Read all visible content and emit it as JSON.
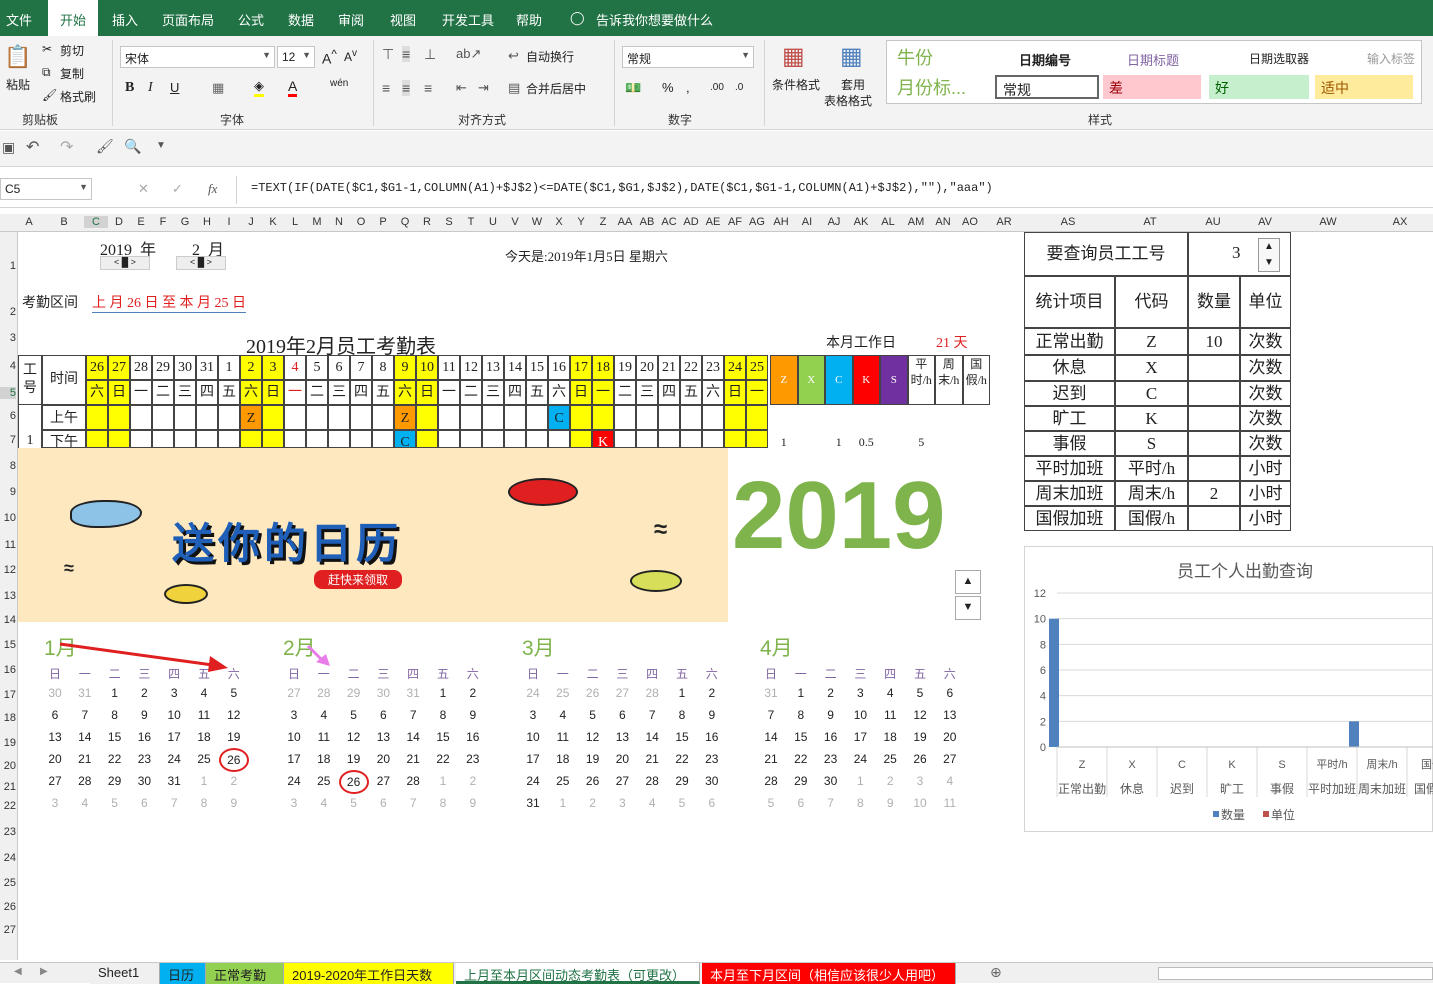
{
  "ribbon_tabs": [
    "文件",
    "开始",
    "插入",
    "页面布局",
    "公式",
    "数据",
    "审阅",
    "视图",
    "开发工具",
    "帮助",
    "告诉我你想要做什么"
  ],
  "clipboard": {
    "paste": "粘贴",
    "cut": "剪切",
    "copy": "复制",
    "format_painter": "格式刷",
    "group": "剪贴板"
  },
  "font": {
    "name": "宋体",
    "size": "12",
    "group": "字体"
  },
  "alignment": {
    "wrap": "自动换行",
    "merge": "合并后居中",
    "group": "对齐方式"
  },
  "number": {
    "format": "常规",
    "group": "数字",
    "percent": "%"
  },
  "styles": {
    "cond_format": "条件格式",
    "table_format_1": "套用",
    "table_format_2": "表格格式",
    "group": "样式",
    "items": [
      {
        "label": "牛份",
        "color": "#7fb34b"
      },
      {
        "label": "月份标...",
        "color": "#7fb34b"
      },
      {
        "label": "日期编号"
      },
      {
        "label": "日期标题"
      },
      {
        "label": "日期选取器"
      },
      {
        "label": "输入标签"
      },
      {
        "label": "常规"
      },
      {
        "label": "差"
      },
      {
        "label": "好"
      },
      {
        "label": "适中"
      }
    ]
  },
  "namebox": "C5",
  "formula": "=TEXT(IF(DATE($C1,$G1-1,COLUMN(A1)+$J$2)<=DATE($C1,$G1,$J$2),DATE($C1,$G1-1,COLUMN(A1)+$J$2),\"\"),\"aaa\")",
  "fx": "fx",
  "columns": [
    "A",
    "B",
    "C",
    "D",
    "E",
    "F",
    "G",
    "H",
    "I",
    "J",
    "K",
    "L",
    "M",
    "N",
    "O",
    "P",
    "Q",
    "R",
    "S",
    "T",
    "U",
    "V",
    "W",
    "X",
    "Y",
    "Z",
    "AA",
    "AB",
    "AC",
    "AD",
    "AE",
    "AF",
    "AG",
    "AH",
    "AI",
    "AJ",
    "AK",
    "AL",
    "AM",
    "AN",
    "AO",
    "AR",
    "AS",
    "AT",
    "AU",
    "AV",
    "AW",
    "AX"
  ],
  "rows": [
    "1",
    "2",
    "3",
    "4",
    "5",
    "6",
    "7",
    "8",
    "9",
    "10",
    "11",
    "12",
    "13",
    "14",
    "15",
    "16",
    "17",
    "18",
    "19",
    "20",
    "21",
    "22",
    "23",
    "24",
    "25",
    "26",
    "27"
  ],
  "sheet": {
    "year": "2019",
    "year_unit": "年",
    "month": "2",
    "month_unit": "月",
    "today": "今天是:2019年1月5日 星期六",
    "range_label": "考勤区间",
    "range_value": "上 月 26 日 至 本 月 25 日",
    "title": "2019年2月员工考勤表",
    "workdays_label": "本月工作日",
    "workdays_value": "21",
    "workdays_unit": "天",
    "col_id": "工号",
    "col_time": "时间",
    "dates": [
      "26",
      "27",
      "28",
      "29",
      "30",
      "31",
      "1",
      "2",
      "3",
      "4",
      "5",
      "6",
      "7",
      "8",
      "9",
      "10",
      "11",
      "12",
      "13",
      "14",
      "15",
      "16",
      "17",
      "18",
      "19",
      "20",
      "21",
      "22",
      "23",
      "24",
      "25"
    ],
    "weekdays": [
      "六",
      "日",
      "一",
      "二",
      "三",
      "四",
      "五",
      "六",
      "日",
      "一",
      "二",
      "三",
      "四",
      "五",
      "六",
      "日",
      "一",
      "二",
      "三",
      "四",
      "五",
      "六",
      "日",
      "一",
      "二",
      "三",
      "四",
      "五",
      "六",
      "日",
      "一"
    ],
    "summary_cols": [
      "Z",
      "X",
      "C",
      "K",
      "S",
      "平时/h",
      "周末/h",
      "国假/h"
    ],
    "am": "上午",
    "pm": "下午",
    "emp_id": "1",
    "marks": {
      "z1": "Z",
      "z2": "Z",
      "c1": "C",
      "c2": "C",
      "k1": "K"
    },
    "summary_vals": [
      "1",
      "1",
      "0.5",
      "5"
    ]
  },
  "banner": {
    "title": "送你的日历",
    "subtitle": "赶快来领取",
    "year": "2019"
  },
  "calendar": {
    "weekday_header": [
      "日",
      "一",
      "二",
      "三",
      "四",
      "五",
      "六"
    ],
    "months": [
      {
        "name": "1月",
        "days": [
          "30",
          "31",
          "1",
          "2",
          "3",
          "4",
          "5",
          "6",
          "7",
          "8",
          "9",
          "10",
          "11",
          "12",
          "13",
          "14",
          "15",
          "16",
          "17",
          "18",
          "19",
          "20",
          "21",
          "22",
          "23",
          "24",
          "25",
          "26",
          "27",
          "28",
          "29",
          "30",
          "31",
          "1",
          "2",
          "3",
          "4",
          "5",
          "6",
          "7",
          "8",
          "9"
        ]
      },
      {
        "name": "2月",
        "days": [
          "27",
          "28",
          "29",
          "30",
          "31",
          "1",
          "2",
          "3",
          "4",
          "5",
          "6",
          "7",
          "8",
          "9",
          "10",
          "11",
          "12",
          "13",
          "14",
          "15",
          "16",
          "17",
          "18",
          "19",
          "20",
          "21",
          "22",
          "23",
          "24",
          "25",
          "26",
          "27",
          "28",
          "1",
          "2",
          "3",
          "4",
          "5",
          "6",
          "7",
          "8",
          "9"
        ]
      },
      {
        "name": "3月",
        "days": [
          "24",
          "25",
          "26",
          "27",
          "28",
          "1",
          "2",
          "3",
          "4",
          "5",
          "6",
          "7",
          "8",
          "9",
          "10",
          "11",
          "12",
          "13",
          "14",
          "15",
          "16",
          "17",
          "18",
          "19",
          "20",
          "21",
          "22",
          "23",
          "24",
          "25",
          "26",
          "27",
          "28",
          "29",
          "30",
          "31",
          "1",
          "2",
          "3",
          "4",
          "5",
          "6"
        ]
      },
      {
        "name": "4月",
        "days": [
          "31",
          "1",
          "2",
          "3",
          "4",
          "5",
          "6",
          "7",
          "8",
          "9",
          "10",
          "11",
          "12",
          "13",
          "14",
          "15",
          "16",
          "17",
          "18",
          "19",
          "20",
          "21",
          "22",
          "23",
          "24",
          "25",
          "26",
          "27",
          "28",
          "29",
          "30",
          "1",
          "2",
          "3",
          "4",
          "5",
          "6",
          "7",
          "8",
          "9",
          "10",
          "11"
        ]
      }
    ]
  },
  "query": {
    "label": "要查询员工工号",
    "value": "3",
    "headers": [
      "统计项目",
      "代码",
      "数量",
      "单位"
    ],
    "rows": [
      [
        "正常出勤",
        "Z",
        "10",
        "次数"
      ],
      [
        "休息",
        "X",
        "",
        "次数"
      ],
      [
        "迟到",
        "C",
        "",
        "次数"
      ],
      [
        "旷工",
        "K",
        "",
        "次数"
      ],
      [
        "事假",
        "S",
        "",
        "次数"
      ],
      [
        "平时加班",
        "平时/h",
        "",
        "小时"
      ],
      [
        "周末加班",
        "周末/h",
        "2",
        "小时"
      ],
      [
        "国假加班",
        "国假/h",
        "",
        "小时"
      ]
    ]
  },
  "chart_data": {
    "type": "bar",
    "title": "员工个人出勤查询",
    "categories": [
      "Z 正常出勤",
      "X 休息",
      "C 迟到",
      "K 旷工",
      "S 事假",
      "平时/h 平时加班",
      "周末/h 周末加班",
      "国假/h 国假加班"
    ],
    "category_codes": [
      "Z",
      "X",
      "C",
      "K",
      "S",
      "平时/h",
      "周末/h",
      "国假"
    ],
    "category_names": [
      "正常出勤",
      "休息",
      "迟到",
      "旷工",
      "事假",
      "平时加班",
      "周末加班",
      "国假加"
    ],
    "series": [
      {
        "name": "数量",
        "values": [
          10,
          0,
          0,
          0,
          0,
          0,
          2,
          0
        ],
        "color": "#4f81bd"
      },
      {
        "name": "单位",
        "values": [
          0,
          0,
          0,
          0,
          0,
          0,
          0,
          0
        ],
        "color": "#c0504d"
      }
    ],
    "ylim": [
      0,
      12
    ],
    "yticks": [
      "0",
      "2",
      "4",
      "6",
      "8",
      "10",
      "12"
    ]
  },
  "sheet_tabs": [
    "Sheet1",
    "日历",
    "正常考勤",
    "2019-2020年工作日天数",
    "上月至本月区间动态考勤表（可更改）",
    "本月至下月区间（相信应该很少人用吧）"
  ]
}
